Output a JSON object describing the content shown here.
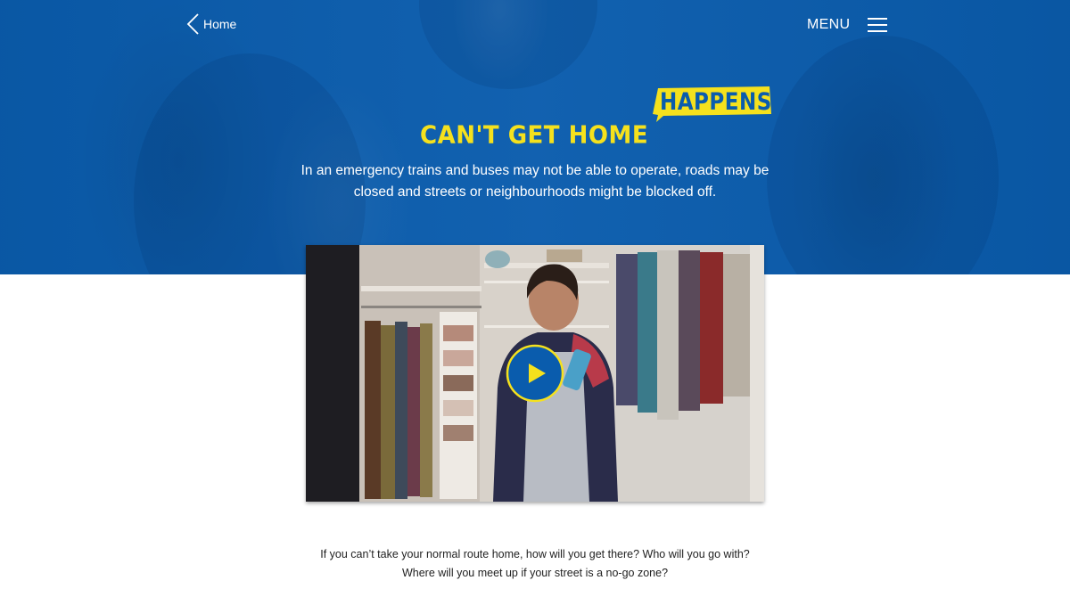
{
  "nav": {
    "home_label": "Home",
    "menu_label": "MENU"
  },
  "hero": {
    "headline": "CAN'T GET HOME",
    "badge": "HAPPENS",
    "intro_line1": "In an emergency trains and buses may not be able to operate, roads may be",
    "intro_line2": "closed and streets or neighbourhoods might be blocked off."
  },
  "video": {
    "play_icon": "play-icon"
  },
  "body": {
    "line1": "If you can’t take your normal route home, how will you get there? Who will you go with?",
    "line2": "Where will you meet up if your street is a no-go zone?"
  },
  "colors": {
    "hero_blue": "#0a5cad",
    "accent_yellow": "#f5e11d",
    "text_dark": "#222222"
  }
}
